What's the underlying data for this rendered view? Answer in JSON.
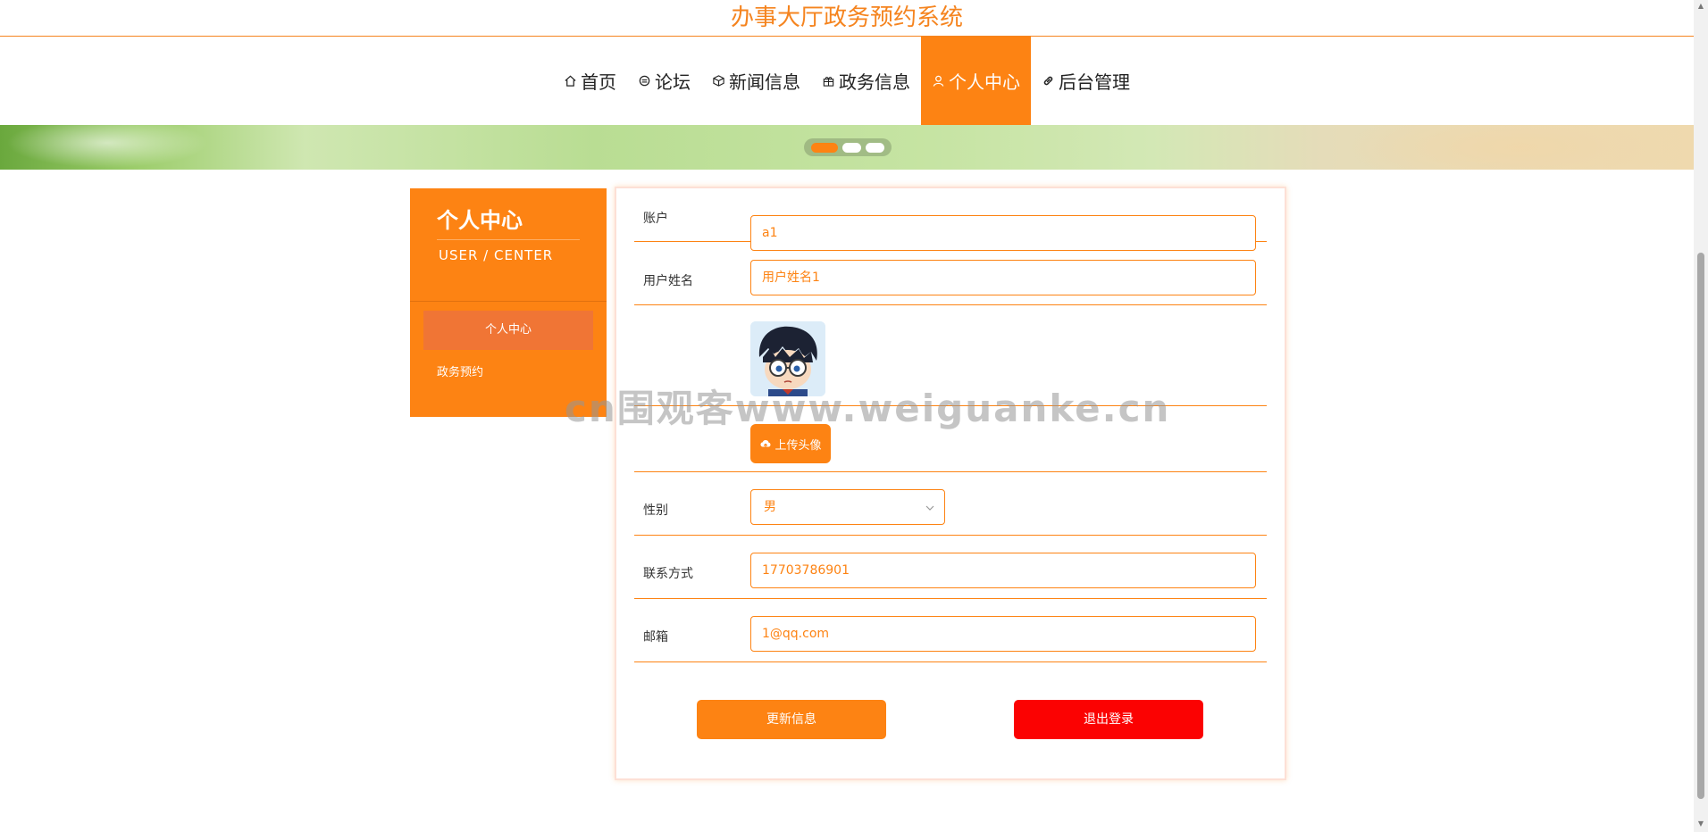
{
  "header": {
    "site_title": "办事大厅政务预约系统"
  },
  "nav": {
    "items": [
      {
        "label": "首页",
        "icon": "home-icon"
      },
      {
        "label": "论坛",
        "icon": "forum-icon"
      },
      {
        "label": "新闻信息",
        "icon": "news-icon"
      },
      {
        "label": "政务信息",
        "icon": "gift-icon"
      },
      {
        "label": "个人中心",
        "icon": "user-icon",
        "active": true
      },
      {
        "label": "后台管理",
        "icon": "link-icon"
      }
    ]
  },
  "banner": {
    "slides": 3,
    "active_slide": 1
  },
  "sidebar": {
    "title": "个人中心",
    "subtitle": "USER / CENTER",
    "menu": [
      {
        "label": "个人中心",
        "active": true
      },
      {
        "label": "政务预约"
      }
    ]
  },
  "form": {
    "account": {
      "label": "账户",
      "value": "a1"
    },
    "name": {
      "label": "用户姓名",
      "value": "用户姓名1"
    },
    "upload_label": "上传头像",
    "gender": {
      "label": "性别",
      "value": "男"
    },
    "phone": {
      "label": "联系方式",
      "value": "17703786901"
    },
    "email": {
      "label": "邮箱",
      "value": "1@qq.com"
    },
    "update_button": "更新信息",
    "logout_button": "退出登录"
  },
  "watermark": {
    "text": "cn围观客www.weiguanke.cn"
  },
  "colors": {
    "accent": "#fd8313",
    "danger": "#fb0202",
    "title": "#f5841f"
  }
}
